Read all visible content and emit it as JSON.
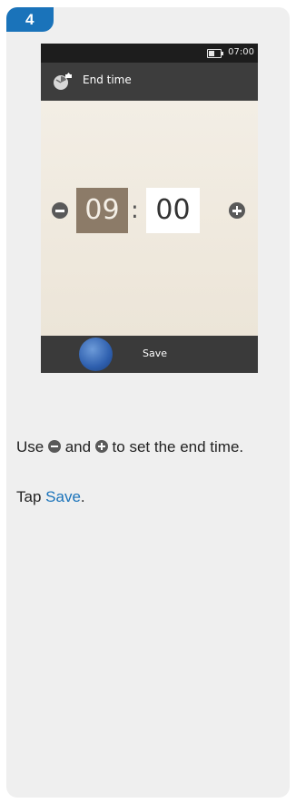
{
  "step": {
    "number": "4"
  },
  "device": {
    "status_bar": {
      "time": "07:00",
      "battery_icon": "battery-icon"
    },
    "title_bar": {
      "icon": "clock-settings-icon",
      "title": "End time"
    },
    "time_picker": {
      "hours": "09",
      "separator": ":",
      "minutes": "00"
    },
    "bottom_bar": {
      "save_label": "Save"
    }
  },
  "instructions": {
    "line1_prefix": "Use",
    "line1_and": "and",
    "line1_suffix": "to set the end time.",
    "line2_prefix": "Tap",
    "line2_link": "Save",
    "line2_suffix": "."
  },
  "colors": {
    "accent": "#1a73ba",
    "selected_box": "#8c7b68",
    "bar_dark": "#3d3d3d"
  }
}
